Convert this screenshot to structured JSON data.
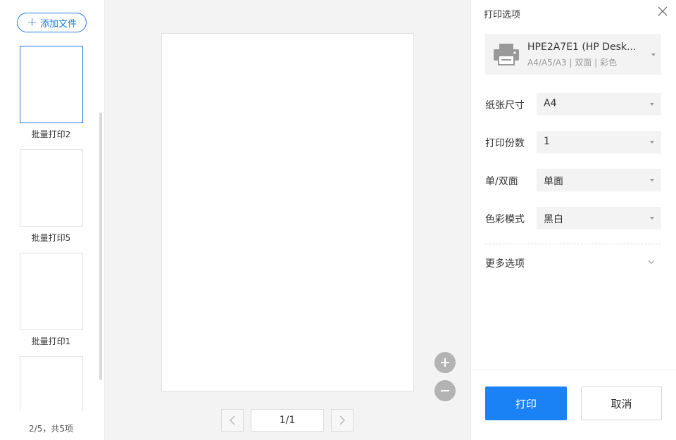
{
  "sidebar": {
    "add_button_label": "添加文件",
    "thumbnails": [
      {
        "label": "批量打印2",
        "selected": true
      },
      {
        "label": "批量打印5",
        "selected": false
      },
      {
        "label": "批量打印1",
        "selected": false
      },
      {
        "label": "",
        "selected": false
      }
    ],
    "page_count": "2/5，共5项"
  },
  "preview": {
    "page_indicator": "1/1"
  },
  "panel": {
    "title": "打印选项",
    "printer": {
      "name": "HPE2A7E1 (HP Desk...",
      "details": "A4/A5/A3 | 双面 | 彩色"
    },
    "options": [
      {
        "label": "纸张尺寸",
        "value": "A4"
      },
      {
        "label": "打印份数",
        "value": "1"
      },
      {
        "label": "单/双面",
        "value": "单面"
      },
      {
        "label": "色彩模式",
        "value": "黑白"
      }
    ],
    "more_options_label": "更多选项",
    "print_label": "打印",
    "cancel_label": "取消"
  },
  "colors": {
    "accent": "#1b82f6",
    "selected_border": "#1f7ae0"
  },
  "icons": {
    "add": "plus-icon",
    "close": "close-icon",
    "printer": "printer-icon",
    "zoom_in": "zoom-in-icon",
    "zoom_out": "zoom-out-icon",
    "prev": "chevron-left-icon",
    "next": "chevron-right-icon",
    "dropdown": "caret-down-icon",
    "expand": "chevron-down-icon"
  }
}
